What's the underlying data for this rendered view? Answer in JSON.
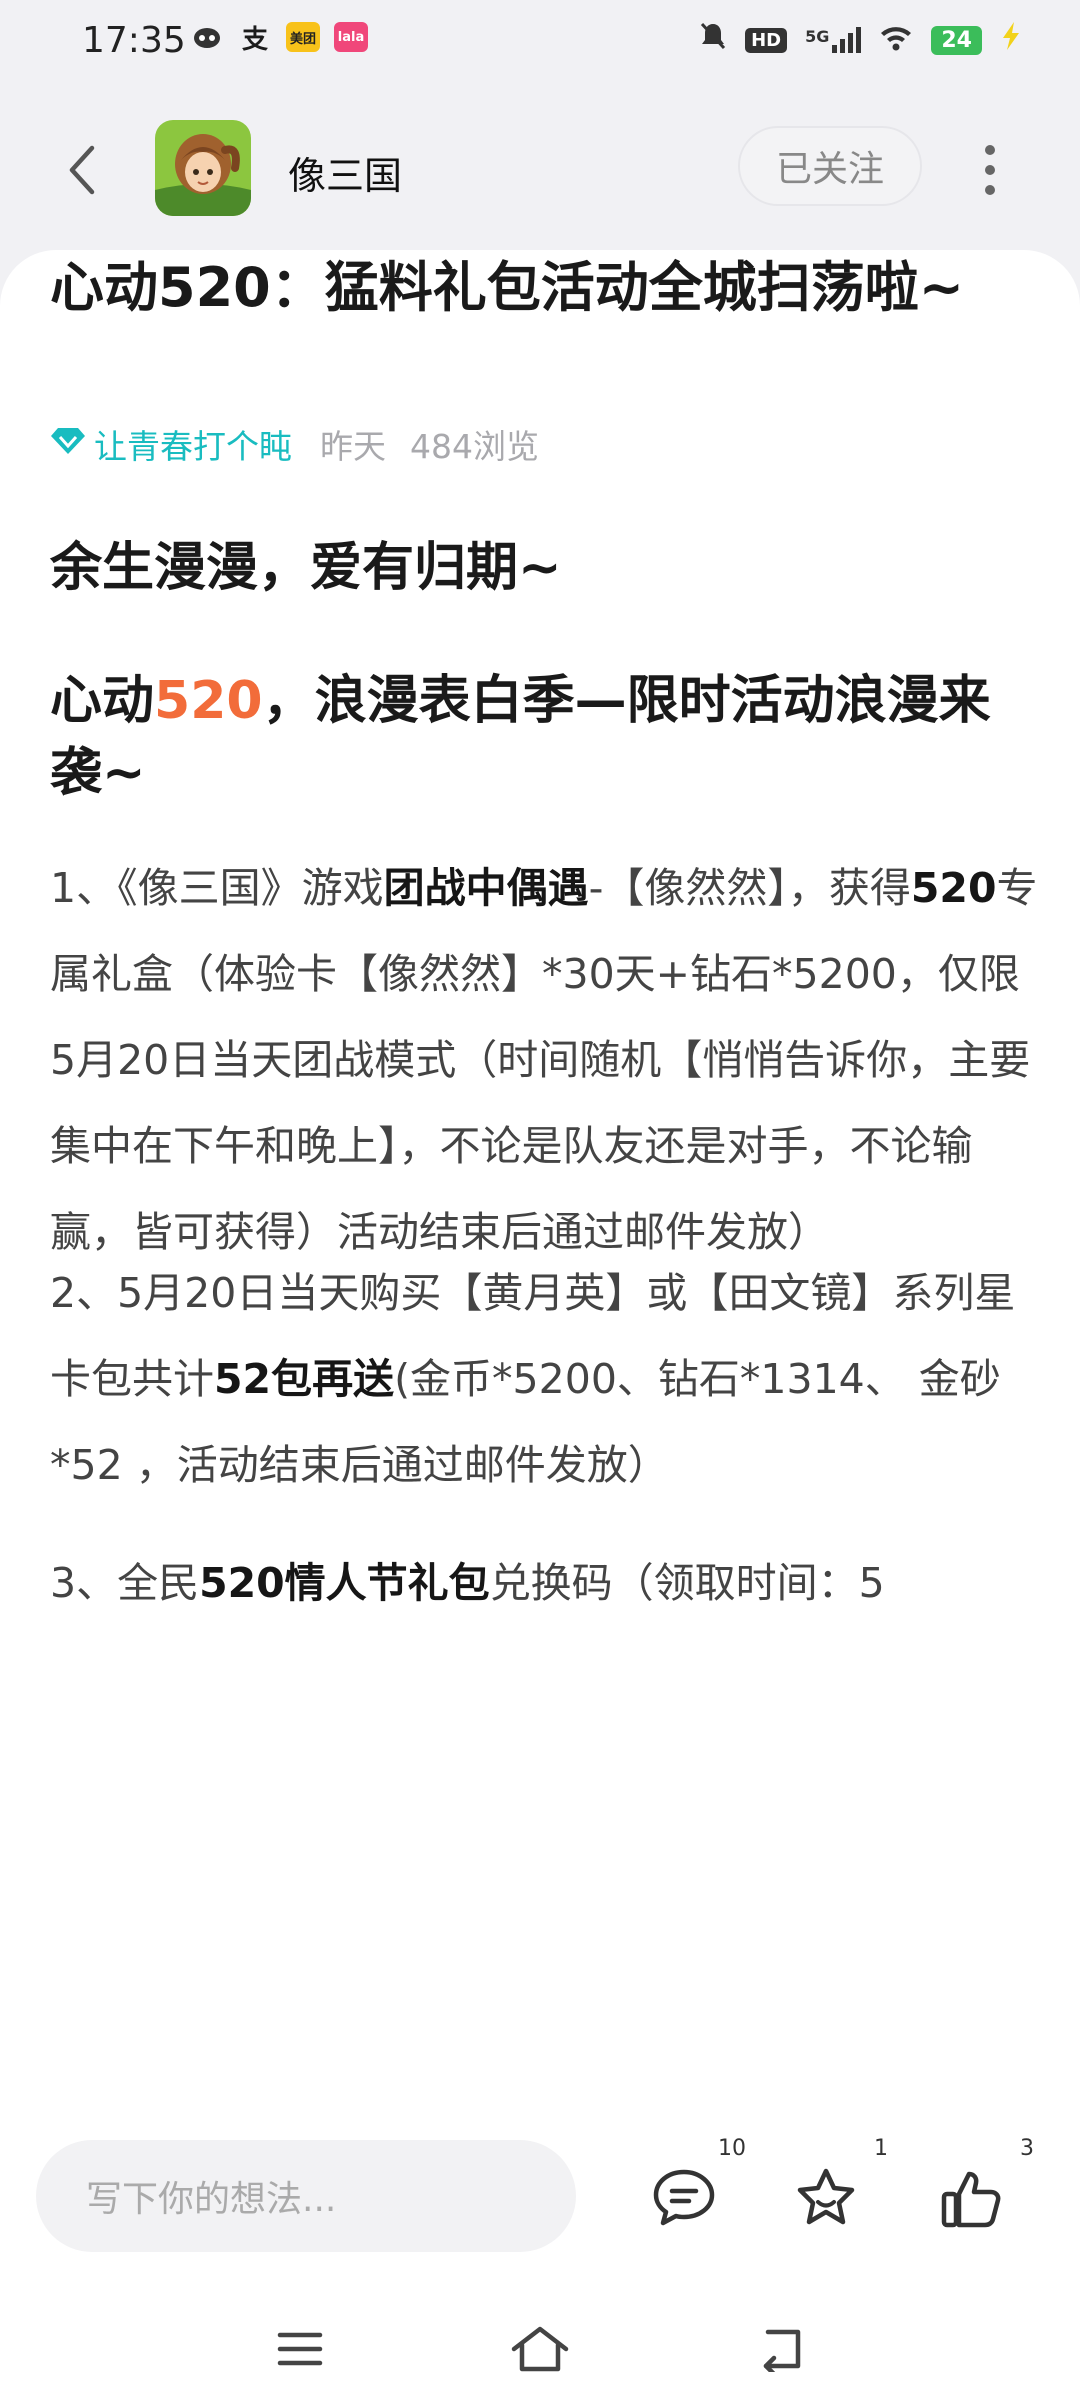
{
  "status_bar": {
    "time": "17:35",
    "apps": [
      {
        "name": "robot-icon",
        "label": "",
        "bg": "#ffffff",
        "fg": "#333333"
      },
      {
        "name": "alipay-icon",
        "label": "支",
        "bg": "#ffffff",
        "fg": "#333333"
      },
      {
        "name": "meituan-icon",
        "label": "美团",
        "bg": "#f8c21a",
        "fg": "#222222"
      },
      {
        "name": "bilibili-icon",
        "label": "lala",
        "bg": "#f0477a",
        "fg": "#ffffff"
      }
    ],
    "hd_label": "HD",
    "network_label": "5G",
    "battery": "24"
  },
  "nav": {
    "channel_name": "像三国",
    "follow_label": "已关注"
  },
  "post": {
    "title": "心动520：猛料礼包活动全城扫荡啦~",
    "author": "让青春打个盹",
    "time": "昨天",
    "views": "484浏览",
    "subtitle": "余生漫漫，爱有归期~",
    "headline_a": "心动",
    "headline_highlight": "520",
    "headline_b": "，浪漫表白季—限时活动浪漫来袭~",
    "p1": {
      "a": "1、《像三国》游戏",
      "b_bold": "团战中偶遇",
      "c": "-【像然然】，获得",
      "d_orange": "520",
      "e": "专属礼盒（体验卡【像然然】*30天+钻石*5200，仅限5月20日当天团战模式（时间随机【悄悄告诉你，主要集中在下午和晚上】，不论是队友还是对手，不论输赢，皆可获得）活动结束后通过邮件发放）"
    },
    "p2": {
      "a": "2、5月20日当天购买【黄月英】或【田文镜】系列星卡包共计",
      "b_bold": "52包",
      "c_orange": "再送",
      "d": "(金币*5200、钻石*1314、 金砂*52 ，活动结束后通过邮件发放）"
    },
    "p3": {
      "a": "3、全民",
      "b_orange": "520情人节礼包",
      "c": "兑换码（领取时间：5"
    }
  },
  "bottom": {
    "input_placeholder": "写下你的想法...",
    "comment_count": "10",
    "star_count": "1",
    "like_count": "3"
  },
  "colors": {
    "accent_orange": "#f26c3a",
    "author_teal": "#19bcc0"
  }
}
